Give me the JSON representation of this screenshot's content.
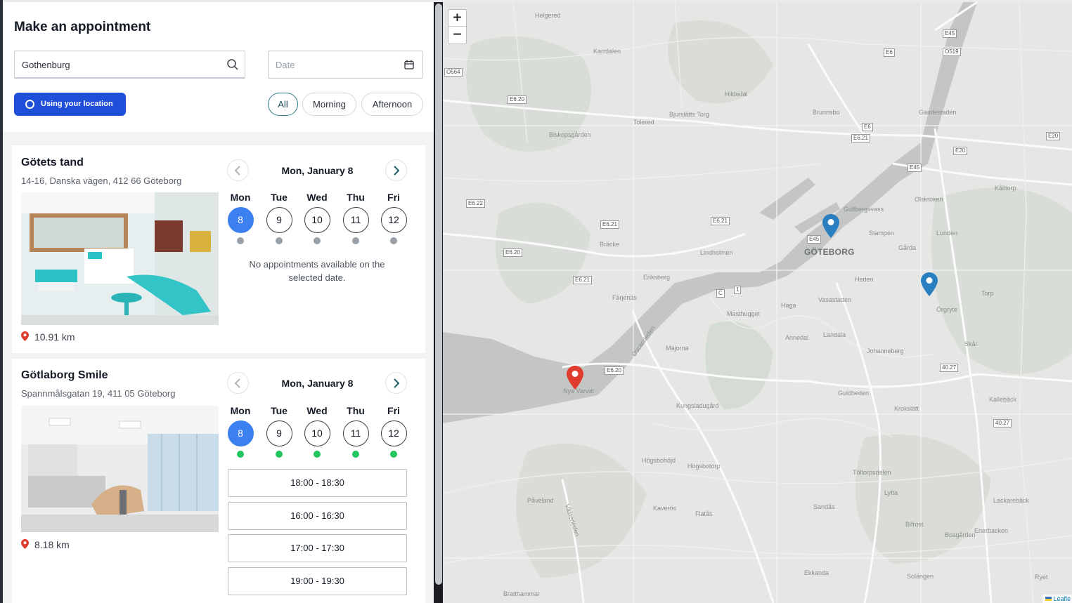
{
  "header": {
    "title": "Make an appointment",
    "search_value": "Gothenburg",
    "date_placeholder": "Date",
    "location_button": "Using your location",
    "filters": [
      "All",
      "Morning",
      "Afternoon"
    ],
    "active_filter": "All"
  },
  "clinics": [
    {
      "name": "Götets tand",
      "address": "14-16, Danska vägen, 412 66 Göteborg",
      "distance": "10.91 km",
      "selected_date": "Mon, January 8",
      "days": [
        {
          "name": "Mon",
          "num": "8"
        },
        {
          "name": "Tue",
          "num": "9"
        },
        {
          "name": "Wed",
          "num": "10"
        },
        {
          "name": "Thu",
          "num": "11"
        },
        {
          "name": "Fri",
          "num": "12"
        }
      ],
      "message": "No appointments available on the selected date."
    },
    {
      "name": "Götlaborg Smile",
      "address": "Spannmålsgatan 19, 411 05 Göteborg",
      "distance": "8.18 km",
      "selected_date": "Mon, January 8",
      "days": [
        {
          "name": "Mon",
          "num": "8"
        },
        {
          "name": "Tue",
          "num": "9"
        },
        {
          "name": "Wed",
          "num": "10"
        },
        {
          "name": "Thu",
          "num": "11"
        },
        {
          "name": "Fri",
          "num": "12"
        }
      ],
      "slots": [
        "18:00 - 18:30",
        "16:00 - 16:30",
        "17:00 - 17:30",
        "19:00 - 19:30"
      ]
    }
  ],
  "map": {
    "zoom_in": "+",
    "zoom_out": "−",
    "attribution": "Leafle",
    "city_label": "GÖTEBORG",
    "labels": [
      "Helgered",
      "Karrdalen",
      "Hildedal",
      "Bjurslätts Torg",
      "Tolered",
      "Brunnsbo",
      "Gamlestaden",
      "Biskopsgården",
      "Gullbergsvass",
      "Olskroken",
      "Kålltorp",
      "Stampen",
      "Lunden",
      "Bräcke",
      "Lindholmen",
      "Gårda",
      "Eriksberg",
      "Heden",
      "Torp",
      "Färjenäs",
      "Haga",
      "Vasastaden",
      "Örgryte",
      "Masthugget",
      "Landala",
      "Annedal",
      "Majorna",
      "Johanneberg",
      "Skår",
      "Nya Varvet",
      "Kungsladugård",
      "Guldheden",
      "Krokslätt",
      "Kallebäck",
      "Högsbohöjd",
      "Högsbotorp",
      "Töltorpsdalen",
      "Påveland",
      "Kaverös",
      "Flatås",
      "Sandås",
      "Lyfta",
      "Lackarebäck",
      "Bifrost",
      "Enerbacken",
      "Bosgården",
      "Ekkanda",
      "Solängen",
      "Bratthammar",
      "Ryet",
      "Västerleden",
      "Oscarsleden"
    ],
    "roads": [
      "E45",
      "O519",
      "E6",
      "O564",
      "E6.20",
      "E6.21",
      "E20",
      "E6.22",
      "C",
      "1",
      "40.27"
    ],
    "colors": {
      "marker_red": "#e03b2f",
      "marker_blue": "#2a7fc1",
      "primary": "#1f4fd8",
      "selected_day": "#3b7ff0"
    }
  }
}
